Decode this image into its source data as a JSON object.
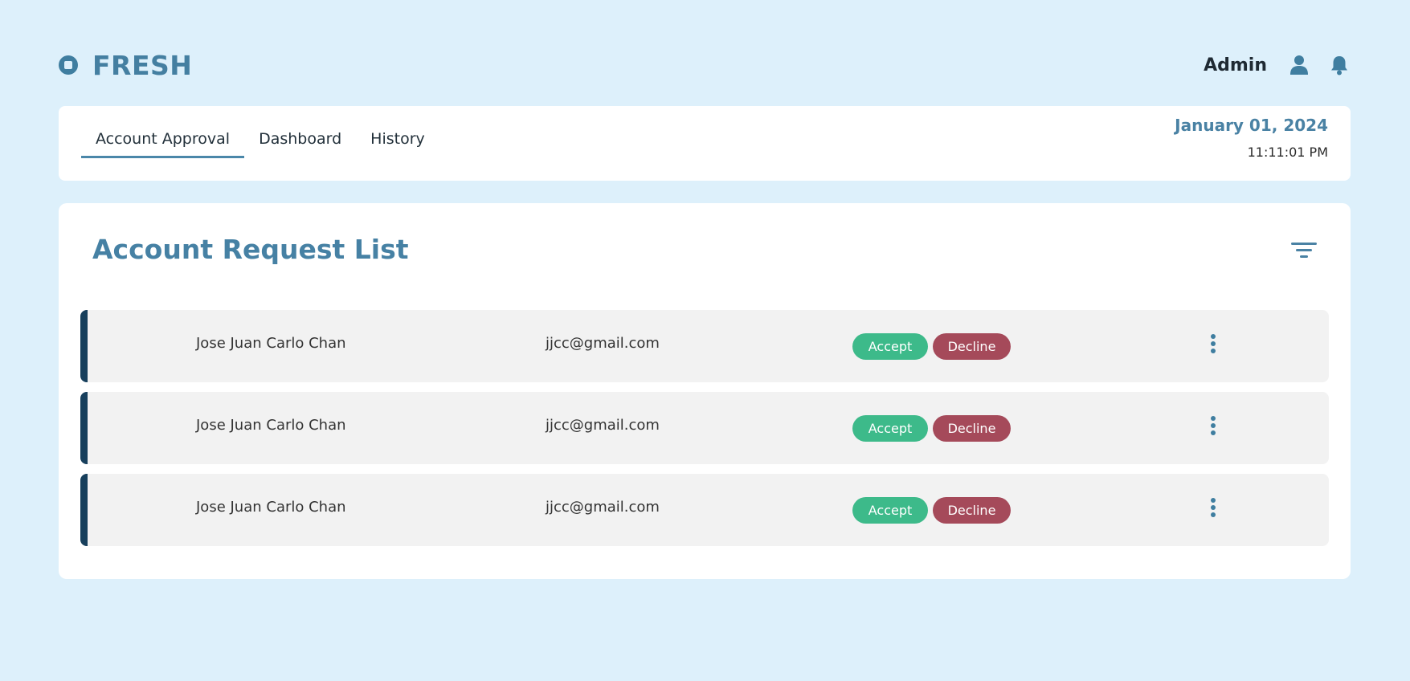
{
  "app": {
    "title": "FRESH"
  },
  "header": {
    "user_label": "Admin",
    "user_icon": "user-icon",
    "bell_icon": "bell-icon"
  },
  "nav": {
    "tabs": [
      {
        "label": "Account Approval",
        "active": true
      },
      {
        "label": "Dashboard",
        "active": false
      },
      {
        "label": "History",
        "active": false
      }
    ],
    "date": "January 01, 2024",
    "time": "11:11:01 PM"
  },
  "list": {
    "title": "Account Request List",
    "filter_icon": "filter-icon",
    "accept_label": "Accept",
    "decline_label": "Decline",
    "rows": [
      {
        "name": "Jose Juan Carlo Chan",
        "email": "jjcc@gmail.com"
      },
      {
        "name": "Jose Juan Carlo Chan",
        "email": "jjcc@gmail.com"
      },
      {
        "name": "Jose Juan Carlo Chan",
        "email": "jjcc@gmail.com"
      }
    ]
  },
  "colors": {
    "background": "#ddf0fb",
    "brand": "#447fa1",
    "accept": "#3dba8a",
    "decline": "#a54a5a",
    "row_accent": "#173f5c"
  }
}
